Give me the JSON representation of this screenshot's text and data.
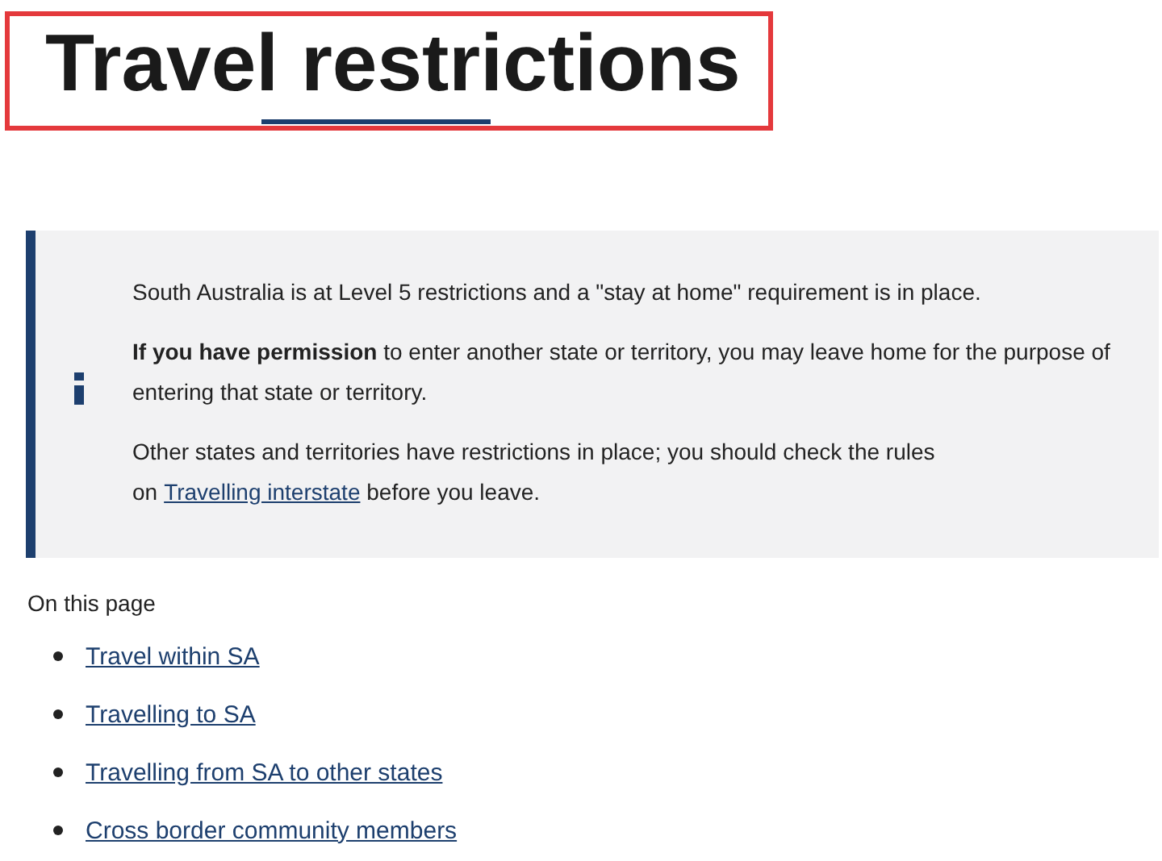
{
  "title": "Travel restrictions",
  "notice": {
    "paragraphs": [
      {
        "text": "South Australia is at Level 5 restrictions and a \"stay at home\" requirement is in place."
      },
      {
        "text": "**If you have permission** to enter another state or territory, you may leave home for the purpose of entering that state or territory."
      },
      {
        "text": "Other states and territories have restrictions in place; you should check the rules on",
        "link": "Travelling interstate",
        "after": "before you leave."
      }
    ]
  },
  "toc": {
    "heading": "On this page",
    "links": [
      "Travel within SA",
      "Travelling to SA",
      "Travelling from SA to other states",
      "Cross border community members"
    ]
  }
}
